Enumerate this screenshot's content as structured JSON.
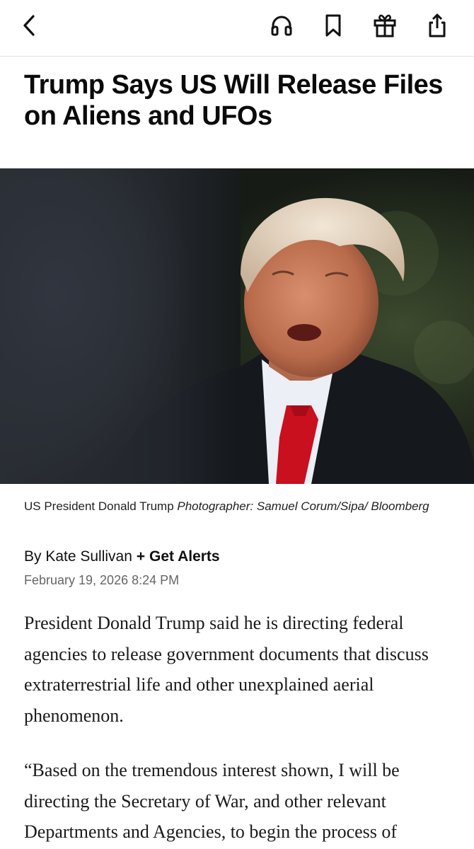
{
  "toolbar": {
    "icons": [
      "chevron-left-icon",
      "headphones-icon",
      "bookmark-icon",
      "gift-icon",
      "share-icon"
    ]
  },
  "article": {
    "headline": "Trump Says US Will Release Files on Aliens and UFOs",
    "image": {
      "caption": "US President Donald Trump",
      "credit": "Photographer: Samuel Corum/Sipa/ Bloomberg"
    },
    "byline": {
      "prefix": "By Kate Sullivan",
      "alerts_label": "+ Get Alerts"
    },
    "date": "February 19, 2026 8:24 PM",
    "paragraphs": [
      "President Donald Trump said he is directing federal agencies to release government documents that discuss extraterrestrial life and other unexplained aerial phenomenon.",
      "“Based on the tremendous interest shown, I will be directing the Secretary of War, and other relevant Departments and Agencies, to begin the process of"
    ]
  },
  "colors": {
    "text": "#111111",
    "muted": "#666666",
    "divider": "#e2e2e2",
    "tie_red": "#c8101e"
  }
}
